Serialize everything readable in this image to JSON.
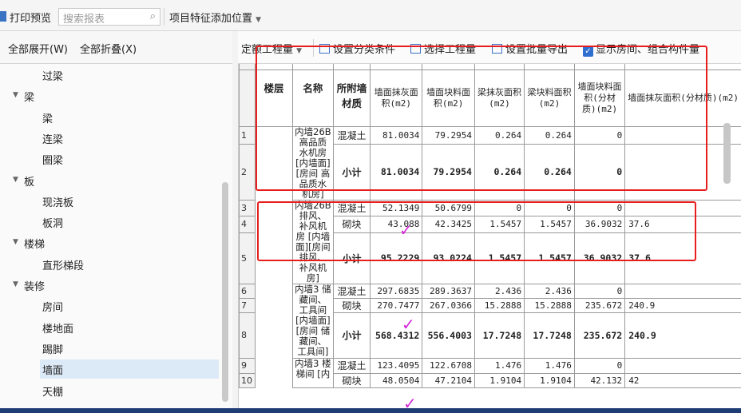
{
  "window": {
    "minimize": "—",
    "maximize": "□",
    "close": "✕"
  },
  "toolbar": {
    "print_preview": "打印预览",
    "search_placeholder": "搜索报表",
    "add_position": "项目特征添加位置",
    "expand_all": "全部展开(W)",
    "collapse_all": "全部折叠(X)"
  },
  "table_toolbar": {
    "quota": "定额工程量",
    "set_category": "设置分类条件",
    "select_qty": "选择工程量",
    "batch_export": "设置批量导出",
    "show_rooms": "显示房间、组合构件量"
  },
  "tree": [
    {
      "label": "过梁",
      "level": 2
    },
    {
      "label": "梁",
      "level": 1,
      "expanded": true
    },
    {
      "label": "梁",
      "level": 2
    },
    {
      "label": "连梁",
      "level": 2
    },
    {
      "label": "圈梁",
      "level": 2
    },
    {
      "label": "板",
      "level": 1,
      "expanded": true
    },
    {
      "label": "现浇板",
      "level": 2
    },
    {
      "label": "板洞",
      "level": 2
    },
    {
      "label": "楼梯",
      "level": 1,
      "expanded": true
    },
    {
      "label": "直形梯段",
      "level": 2
    },
    {
      "label": "装修",
      "level": 1,
      "expanded": true
    },
    {
      "label": "房间",
      "level": 2
    },
    {
      "label": "楼地面",
      "level": 2
    },
    {
      "label": "踢脚",
      "level": 2
    },
    {
      "label": "墙面",
      "level": 2,
      "selected": true
    },
    {
      "label": "天棚",
      "level": 2
    }
  ],
  "grid": {
    "headers": [
      "楼层",
      "名称",
      "所附墙材质",
      "墙面抹灰面积(m2)",
      "墙面块料面积(m2)",
      "梁抹灰面积(m2)",
      "梁块料面积(m2)",
      "墙面块料面积(分材质)(m2)",
      "墙面抹灰面积(分材质)(m2)"
    ],
    "groups": [
      {
        "name": "内墙26B 高品质水机房 [内墙面][房间 高品质水机房]",
        "rows": [
          {
            "n": "1",
            "mat": "混凝土",
            "v": [
              "81.0034",
              "79.2954",
              "0.264",
              "0.264",
              "0",
              ""
            ]
          },
          {
            "n": "2",
            "mat": "小计",
            "v": [
              "81.0034",
              "79.2954",
              "0.264",
              "0.264",
              "0",
              ""
            ],
            "subtotal": true
          }
        ]
      },
      {
        "name": "内墙26B 排风、补风机房 [内墙面][房间 排风、补风机房]",
        "rows": [
          {
            "n": "3",
            "mat": "混凝土",
            "v": [
              "52.1349",
              "50.6799",
              "0",
              "0",
              "0",
              ""
            ]
          },
          {
            "n": "4",
            "mat": "砌块",
            "v": [
              "43.088",
              "42.3425",
              "1.5457",
              "1.5457",
              "36.9032",
              "37.6"
            ]
          },
          {
            "n": "5",
            "mat": "小计",
            "v": [
              "95.2229",
              "93.0224",
              "1.5457",
              "1.5457",
              "36.9032",
              "37.6"
            ],
            "subtotal": true
          }
        ]
      },
      {
        "name": "内墙3 储藏间、工具间 [内墙面][房间 储藏间、工具间]",
        "rows": [
          {
            "n": "6",
            "mat": "混凝土",
            "v": [
              "297.6835",
              "289.3637",
              "2.436",
              "2.436",
              "0",
              ""
            ]
          },
          {
            "n": "7",
            "mat": "砌块",
            "v": [
              "270.7477",
              "267.0366",
              "15.2888",
              "15.2888",
              "235.672",
              "240.9"
            ]
          },
          {
            "n": "8",
            "mat": "小计",
            "v": [
              "568.4312",
              "556.4003",
              "17.7248",
              "17.7248",
              "235.672",
              "240.9"
            ],
            "subtotal": true
          }
        ]
      },
      {
        "name": "内墙3 楼梯间 [内",
        "rows": [
          {
            "n": "9",
            "mat": "混凝土",
            "v": [
              "123.4095",
              "122.6708",
              "1.476",
              "1.476",
              "0",
              ""
            ]
          },
          {
            "n": "10",
            "mat": "砌块",
            "v": [
              "48.0504",
              "47.2104",
              "1.9104",
              "1.9104",
              "42.132",
              "42"
            ]
          }
        ]
      }
    ]
  },
  "colors": {
    "annotation_red": "#e81d1d",
    "checkmark_magenta": "#d425d8",
    "selection": "#dce9f7"
  }
}
